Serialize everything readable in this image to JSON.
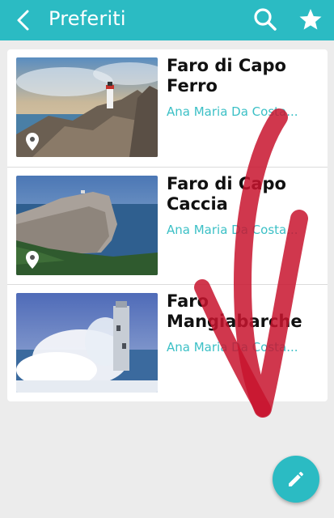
{
  "appbar": {
    "title": "Preferiti",
    "back_icon": "chevron-left-icon",
    "search_icon": "search-icon",
    "star_icon": "star-icon"
  },
  "items": [
    {
      "title": "Faro di Capo Ferro",
      "author": "Ana Maria Da Costa...",
      "has_pin": true
    },
    {
      "title": "Faro di Capo Caccia",
      "author": "Ana Maria Da Costa...",
      "has_pin": true
    },
    {
      "title": "Faro Mangiabarche",
      "author": "Ana Maria Da Costa...",
      "has_pin": false
    }
  ],
  "fab": {
    "icon": "pencil-icon"
  },
  "colors": {
    "accent": "#2bbbc3",
    "author_text": "#3cc0c6",
    "annotation": "#c8142e"
  }
}
